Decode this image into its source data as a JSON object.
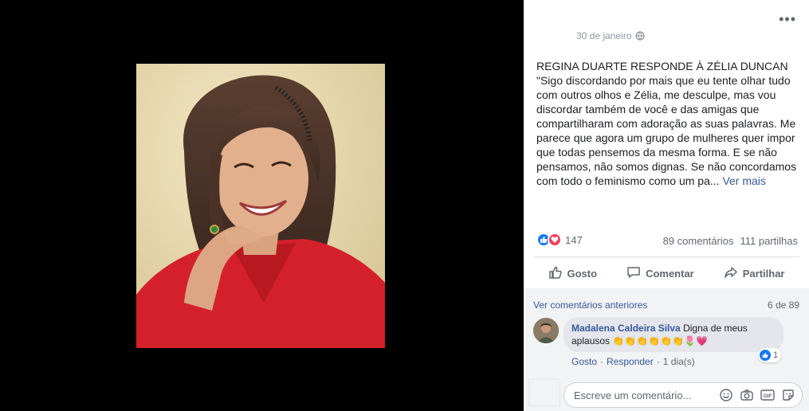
{
  "post": {
    "date": "30 de janeiro",
    "title": "REGINA DUARTE RESPONDE À ZÉLIA DUNCAN",
    "body": "\"Sigo discordando por mais que eu tente olhar tudo com outros olhos e Zélia, me desculpe, mas vou discordar também de você e das amigas que compartilharam com adoração as suas palavras. Me parece que agora um grupo de mulheres quer impor que todas pensemos da mesma forma. E se não pensamos, não somos dignas. Se não concordamos com todo o feminismo como um pa...",
    "see_more": "Ver mais",
    "reaction_count": "147",
    "comments_count": "89 comentários",
    "shares_count": "111 partilhas"
  },
  "actions": {
    "like": "Gosto",
    "comment": "Comentar",
    "share": "Partilhar"
  },
  "comments": {
    "view_previous": "Ver comentários anteriores",
    "paging": "6 de 89",
    "items": [
      {
        "author": "Madalena Caldeira Silva",
        "text": "Digna de meus aplausos",
        "emojis": "👏👏👏👏👏👏🌷💗",
        "likes": "1",
        "like_action": "Gosto",
        "reply_action": "Responder",
        "time": "1 dia(s)"
      }
    ],
    "input_placeholder": "Escreve um comentário..."
  },
  "icons": {
    "globe": "globe-icon",
    "more": "more-options-icon",
    "like": "thumbs-up-icon",
    "love": "heart-icon",
    "comment": "speech-bubble-icon",
    "share": "share-arrow-icon",
    "emoji": "smiley-icon",
    "camera": "camera-icon",
    "gif": "gif-icon",
    "sticker": "sticker-icon"
  },
  "colors": {
    "link": "#385898",
    "like_blue": "#1877f2",
    "love_red": "#f33e58",
    "jacket_red": "#d4202a"
  }
}
